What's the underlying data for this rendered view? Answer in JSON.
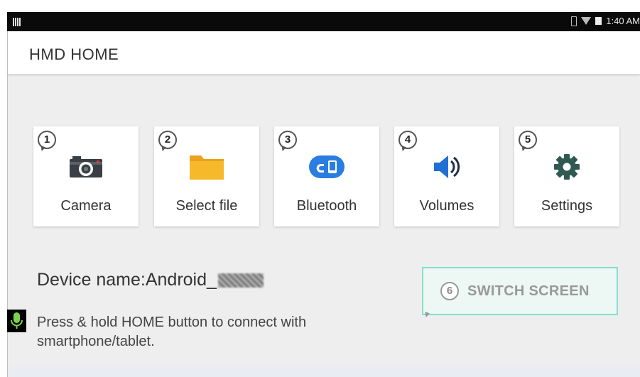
{
  "status_bar": {
    "time": "1:40 AM"
  },
  "app_bar": {
    "title": "HMD HOME"
  },
  "tiles": [
    {
      "number": "1",
      "label": "Camera",
      "icon": "camera-icon"
    },
    {
      "number": "2",
      "label": "Select file",
      "icon": "folder-icon"
    },
    {
      "number": "3",
      "label": "Bluetooth",
      "icon": "bluetooth-link-icon"
    },
    {
      "number": "4",
      "label": "Volumes",
      "icon": "speaker-icon"
    },
    {
      "number": "5",
      "label": "Settings",
      "icon": "gear-icon"
    }
  ],
  "device": {
    "name_label": "Device name:Android_"
  },
  "hint": "Press & hold HOME button to connect with smartphone/tablet.",
  "switch_button": {
    "number": "6",
    "label": "SWITCH SCREEN"
  },
  "colors": {
    "accent_teal": "#83e0cc",
    "folder_yellow": "#f6b92b",
    "bluetooth_blue": "#2a7de1",
    "volume_blue": "#1f6fd6",
    "gear_green": "#2f5a52",
    "mic_green": "#7bd14e"
  }
}
